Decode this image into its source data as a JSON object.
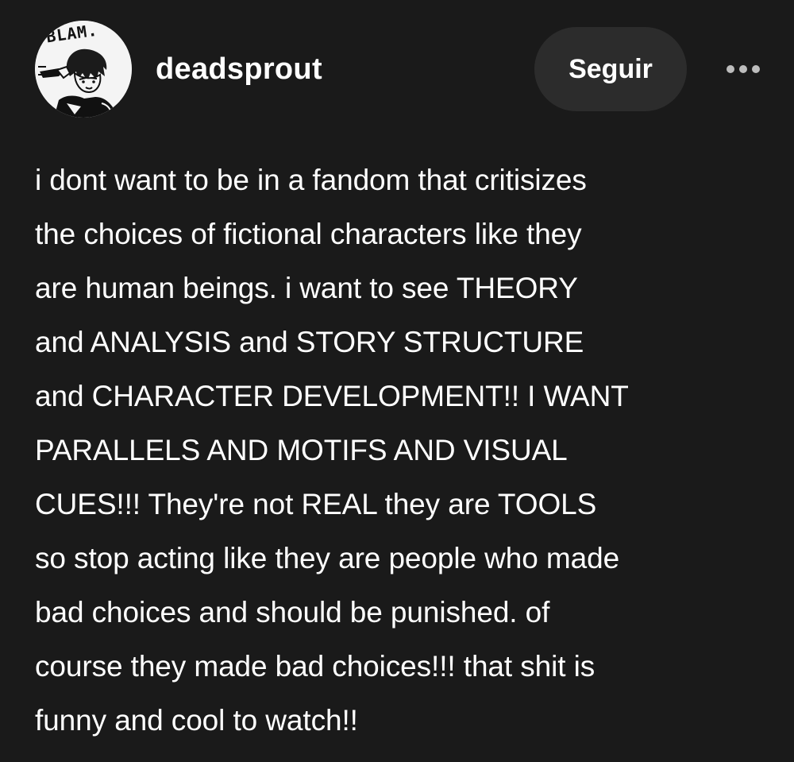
{
  "post": {
    "author": {
      "username": "deadsprout",
      "avatar_caption": "BLAM."
    },
    "follow_label": "Seguir",
    "more_icon": "ellipsis-icon",
    "lines": [
      "i dont want to be in a fandom that critisizes",
      "the choices of fictional characters like they",
      "are human beings. i want to see THEORY",
      "and ANALYSIS and STORY STRUCTURE",
      "and CHARACTER DEVELOPMENT!! I WANT",
      "PARALLELS AND MOTIFS AND VISUAL",
      "CUES!!! They're not REAL they are TOOLS",
      "so stop acting like they are people who made",
      "bad choices and should be punished. of",
      "course they made bad choices!!! that shit is",
      "funny and cool to watch!!"
    ]
  },
  "colors": {
    "background": "#1a1a1a",
    "text": "#ffffff",
    "button_bg": "#2c2c2c",
    "dots": "#bdbdbd"
  }
}
